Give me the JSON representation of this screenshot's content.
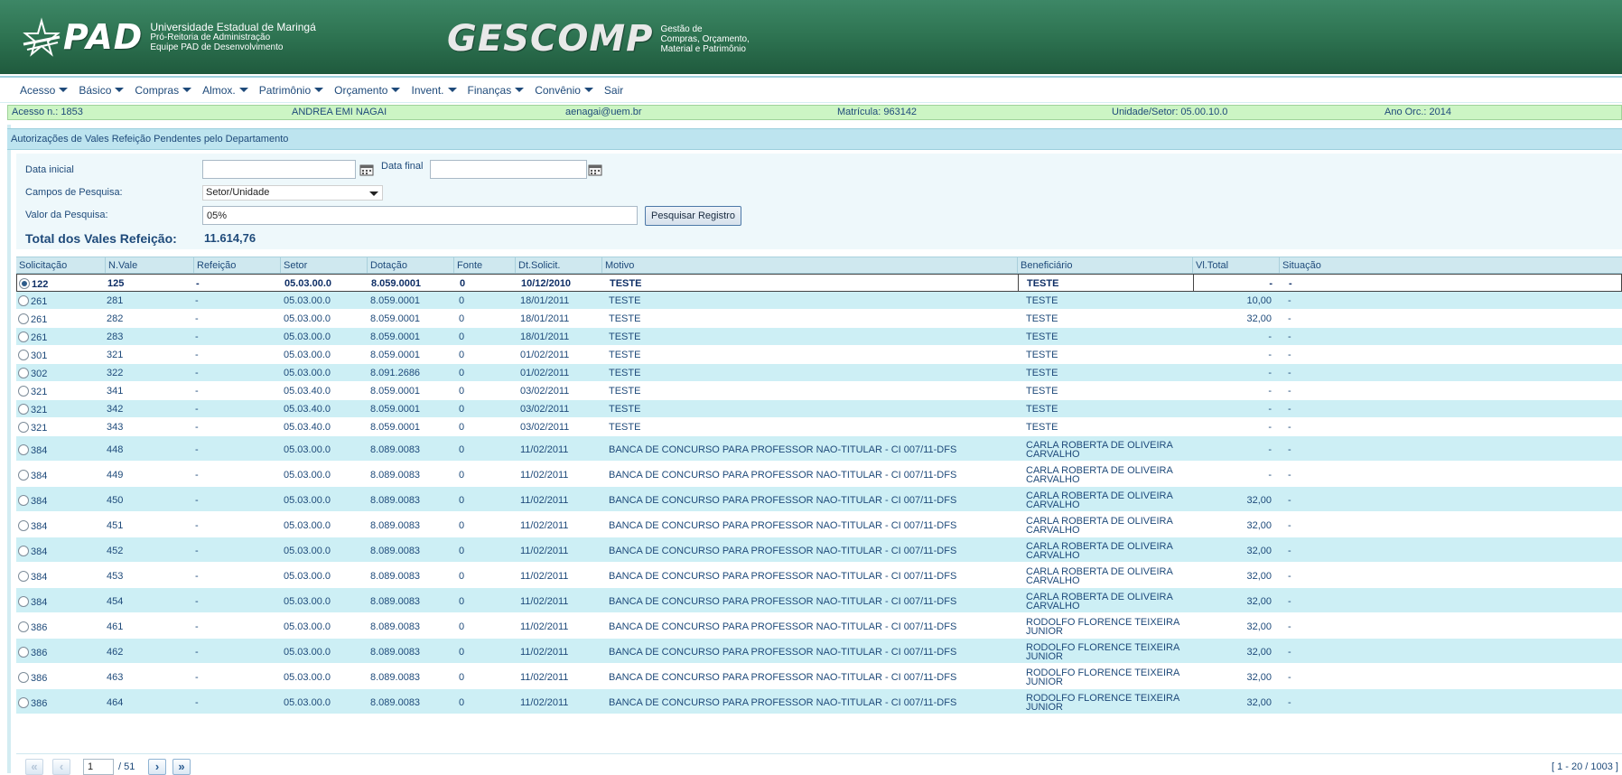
{
  "header": {
    "pad_word": "PAD",
    "pad_line1": "Universidade Estadual de Maringá",
    "pad_line2": "Pró-Reitoria de Administração",
    "pad_line3": "Equipe PAD de Desenvolvimento",
    "gescomp_word": "GESCOMP",
    "gescomp_line1": "Gestão de",
    "gescomp_line2": "Compras, Orçamento,",
    "gescomp_line3": "Material e Patrimônio"
  },
  "menu": [
    {
      "label": "Acesso"
    },
    {
      "label": "Básico"
    },
    {
      "label": "Compras"
    },
    {
      "label": "Almox."
    },
    {
      "label": "Patrimônio"
    },
    {
      "label": "Orçamento"
    },
    {
      "label": "Invent."
    },
    {
      "label": "Finanças"
    },
    {
      "label": "Convênio"
    },
    {
      "label": "Sair"
    }
  ],
  "info": {
    "acesso": "Acesso n.: 1853",
    "nome": "ANDREA EMI NAGAI",
    "email": "aenagai@uem.br",
    "matricula": "Matrícula: 963142",
    "unidade": "Unidade/Setor: 05.00.10.0",
    "ano": "Ano Orc.: 2014"
  },
  "page_title": "Autorizações de Vales Refeição Pendentes pelo Departamento",
  "filters": {
    "data_inicial_label": "Data inicial",
    "data_inicial_value": "",
    "data_final_label": "Data final",
    "data_final_value": "",
    "campos_label": "Campos de Pesquisa:",
    "campos_value": "Setor/Unidade",
    "valor_label": "Valor da Pesquisa:",
    "valor_value": "05%",
    "search_button": "Pesquisar Registro",
    "total_label": "Total dos Vales Refeição:",
    "total_value": "11.614,76"
  },
  "table": {
    "columns": [
      "Solicitação",
      "N.Vale",
      "Refeição",
      "Setor",
      "Dotação",
      "Fonte",
      "Dt.Solicit.",
      "Motivo",
      "Beneficiário",
      "Vl.Total",
      "Situação"
    ],
    "rows": [
      {
        "solic": "122",
        "nvale": "125",
        "refeicao": "-",
        "setor": "05.03.00.0",
        "dotacao": "8.059.0001",
        "fonte": "0",
        "dt": "10/12/2010",
        "motivo": "TESTE",
        "benef": "TESTE",
        "total": "-",
        "situacao": "-",
        "selected": true
      },
      {
        "solic": "261",
        "nvale": "281",
        "refeicao": "-",
        "setor": "05.03.00.0",
        "dotacao": "8.059.0001",
        "fonte": "0",
        "dt": "18/01/2011",
        "motivo": "TESTE",
        "benef": "TESTE",
        "total": "10,00",
        "situacao": "-"
      },
      {
        "solic": "261",
        "nvale": "282",
        "refeicao": "-",
        "setor": "05.03.00.0",
        "dotacao": "8.059.0001",
        "fonte": "0",
        "dt": "18/01/2011",
        "motivo": "TESTE",
        "benef": "TESTE",
        "total": "32,00",
        "situacao": "-"
      },
      {
        "solic": "261",
        "nvale": "283",
        "refeicao": "-",
        "setor": "05.03.00.0",
        "dotacao": "8.059.0001",
        "fonte": "0",
        "dt": "18/01/2011",
        "motivo": "TESTE",
        "benef": "TESTE",
        "total": "-",
        "situacao": "-"
      },
      {
        "solic": "301",
        "nvale": "321",
        "refeicao": "-",
        "setor": "05.03.00.0",
        "dotacao": "8.059.0001",
        "fonte": "0",
        "dt": "01/02/2011",
        "motivo": "TESTE",
        "benef": "TESTE",
        "total": "-",
        "situacao": "-"
      },
      {
        "solic": "302",
        "nvale": "322",
        "refeicao": "-",
        "setor": "05.03.00.0",
        "dotacao": "8.091.2686",
        "fonte": "0",
        "dt": "01/02/2011",
        "motivo": "TESTE",
        "benef": "TESTE",
        "total": "-",
        "situacao": "-"
      },
      {
        "solic": "321",
        "nvale": "341",
        "refeicao": "-",
        "setor": "05.03.40.0",
        "dotacao": "8.059.0001",
        "fonte": "0",
        "dt": "03/02/2011",
        "motivo": "TESTE",
        "benef": "TESTE",
        "total": "-",
        "situacao": "-"
      },
      {
        "solic": "321",
        "nvale": "342",
        "refeicao": "-",
        "setor": "05.03.40.0",
        "dotacao": "8.059.0001",
        "fonte": "0",
        "dt": "03/02/2011",
        "motivo": "TESTE",
        "benef": "TESTE",
        "total": "-",
        "situacao": "-"
      },
      {
        "solic": "321",
        "nvale": "343",
        "refeicao": "-",
        "setor": "05.03.40.0",
        "dotacao": "8.059.0001",
        "fonte": "0",
        "dt": "03/02/2011",
        "motivo": "TESTE",
        "benef": "TESTE",
        "total": "-",
        "situacao": "-"
      },
      {
        "solic": "384",
        "nvale": "448",
        "refeicao": "-",
        "setor": "05.03.00.0",
        "dotacao": "8.089.0083",
        "fonte": "0",
        "dt": "11/02/2011",
        "motivo": "BANCA DE CONCURSO PARA PROFESSOR NAO-TITULAR - CI 007/11-DFS",
        "benef": "CARLA ROBERTA DE OLIVEIRA CARVALHO",
        "total": "-",
        "situacao": "-"
      },
      {
        "solic": "384",
        "nvale": "449",
        "refeicao": "-",
        "setor": "05.03.00.0",
        "dotacao": "8.089.0083",
        "fonte": "0",
        "dt": "11/02/2011",
        "motivo": "BANCA DE CONCURSO PARA PROFESSOR NAO-TITULAR - CI 007/11-DFS",
        "benef": "CARLA ROBERTA DE OLIVEIRA CARVALHO",
        "total": "-",
        "situacao": "-"
      },
      {
        "solic": "384",
        "nvale": "450",
        "refeicao": "-",
        "setor": "05.03.00.0",
        "dotacao": "8.089.0083",
        "fonte": "0",
        "dt": "11/02/2011",
        "motivo": "BANCA DE CONCURSO PARA PROFESSOR NAO-TITULAR - CI 007/11-DFS",
        "benef": "CARLA ROBERTA DE OLIVEIRA CARVALHO",
        "total": "32,00",
        "situacao": "-"
      },
      {
        "solic": "384",
        "nvale": "451",
        "refeicao": "-",
        "setor": "05.03.00.0",
        "dotacao": "8.089.0083",
        "fonte": "0",
        "dt": "11/02/2011",
        "motivo": "BANCA DE CONCURSO PARA PROFESSOR NAO-TITULAR - CI 007/11-DFS",
        "benef": "CARLA ROBERTA DE OLIVEIRA CARVALHO",
        "total": "32,00",
        "situacao": "-"
      },
      {
        "solic": "384",
        "nvale": "452",
        "refeicao": "-",
        "setor": "05.03.00.0",
        "dotacao": "8.089.0083",
        "fonte": "0",
        "dt": "11/02/2011",
        "motivo": "BANCA DE CONCURSO PARA PROFESSOR NAO-TITULAR - CI 007/11-DFS",
        "benef": "CARLA ROBERTA DE OLIVEIRA CARVALHO",
        "total": "32,00",
        "situacao": "-"
      },
      {
        "solic": "384",
        "nvale": "453",
        "refeicao": "-",
        "setor": "05.03.00.0",
        "dotacao": "8.089.0083",
        "fonte": "0",
        "dt": "11/02/2011",
        "motivo": "BANCA DE CONCURSO PARA PROFESSOR NAO-TITULAR - CI 007/11-DFS",
        "benef": "CARLA ROBERTA DE OLIVEIRA CARVALHO",
        "total": "32,00",
        "situacao": "-"
      },
      {
        "solic": "384",
        "nvale": "454",
        "refeicao": "-",
        "setor": "05.03.00.0",
        "dotacao": "8.089.0083",
        "fonte": "0",
        "dt": "11/02/2011",
        "motivo": "BANCA DE CONCURSO PARA PROFESSOR NAO-TITULAR - CI 007/11-DFS",
        "benef": "CARLA ROBERTA DE OLIVEIRA CARVALHO",
        "total": "32,00",
        "situacao": "-"
      },
      {
        "solic": "386",
        "nvale": "461",
        "refeicao": "-",
        "setor": "05.03.00.0",
        "dotacao": "8.089.0083",
        "fonte": "0",
        "dt": "11/02/2011",
        "motivo": "BANCA DE CONCURSO PARA PROFESSOR NAO-TITULAR - CI 007/11-DFS",
        "benef": "RODOLFO FLORENCE TEIXEIRA JUNIOR",
        "total": "32,00",
        "situacao": "-"
      },
      {
        "solic": "386",
        "nvale": "462",
        "refeicao": "-",
        "setor": "05.03.00.0",
        "dotacao": "8.089.0083",
        "fonte": "0",
        "dt": "11/02/2011",
        "motivo": "BANCA DE CONCURSO PARA PROFESSOR NAO-TITULAR - CI 007/11-DFS",
        "benef": "RODOLFO FLORENCE TEIXEIRA JUNIOR",
        "total": "32,00",
        "situacao": "-"
      },
      {
        "solic": "386",
        "nvale": "463",
        "refeicao": "-",
        "setor": "05.03.00.0",
        "dotacao": "8.089.0083",
        "fonte": "0",
        "dt": "11/02/2011",
        "motivo": "BANCA DE CONCURSO PARA PROFESSOR NAO-TITULAR - CI 007/11-DFS",
        "benef": "RODOLFO FLORENCE TEIXEIRA JUNIOR",
        "total": "32,00",
        "situacao": "-"
      },
      {
        "solic": "386",
        "nvale": "464",
        "refeicao": "-",
        "setor": "05.03.00.0",
        "dotacao": "8.089.0083",
        "fonte": "0",
        "dt": "11/02/2011",
        "motivo": "BANCA DE CONCURSO PARA PROFESSOR NAO-TITULAR - CI 007/11-DFS",
        "benef": "RODOLFO FLORENCE TEIXEIRA JUNIOR",
        "total": "32,00",
        "situacao": "-"
      }
    ]
  },
  "pager": {
    "page": "1",
    "of_pages": "/ 51",
    "range": "[ 1 - 20 / 1003 ]",
    "first_symbol": "«",
    "prev_symbol": "‹",
    "next_symbol": "›",
    "last_symbol": "»"
  }
}
